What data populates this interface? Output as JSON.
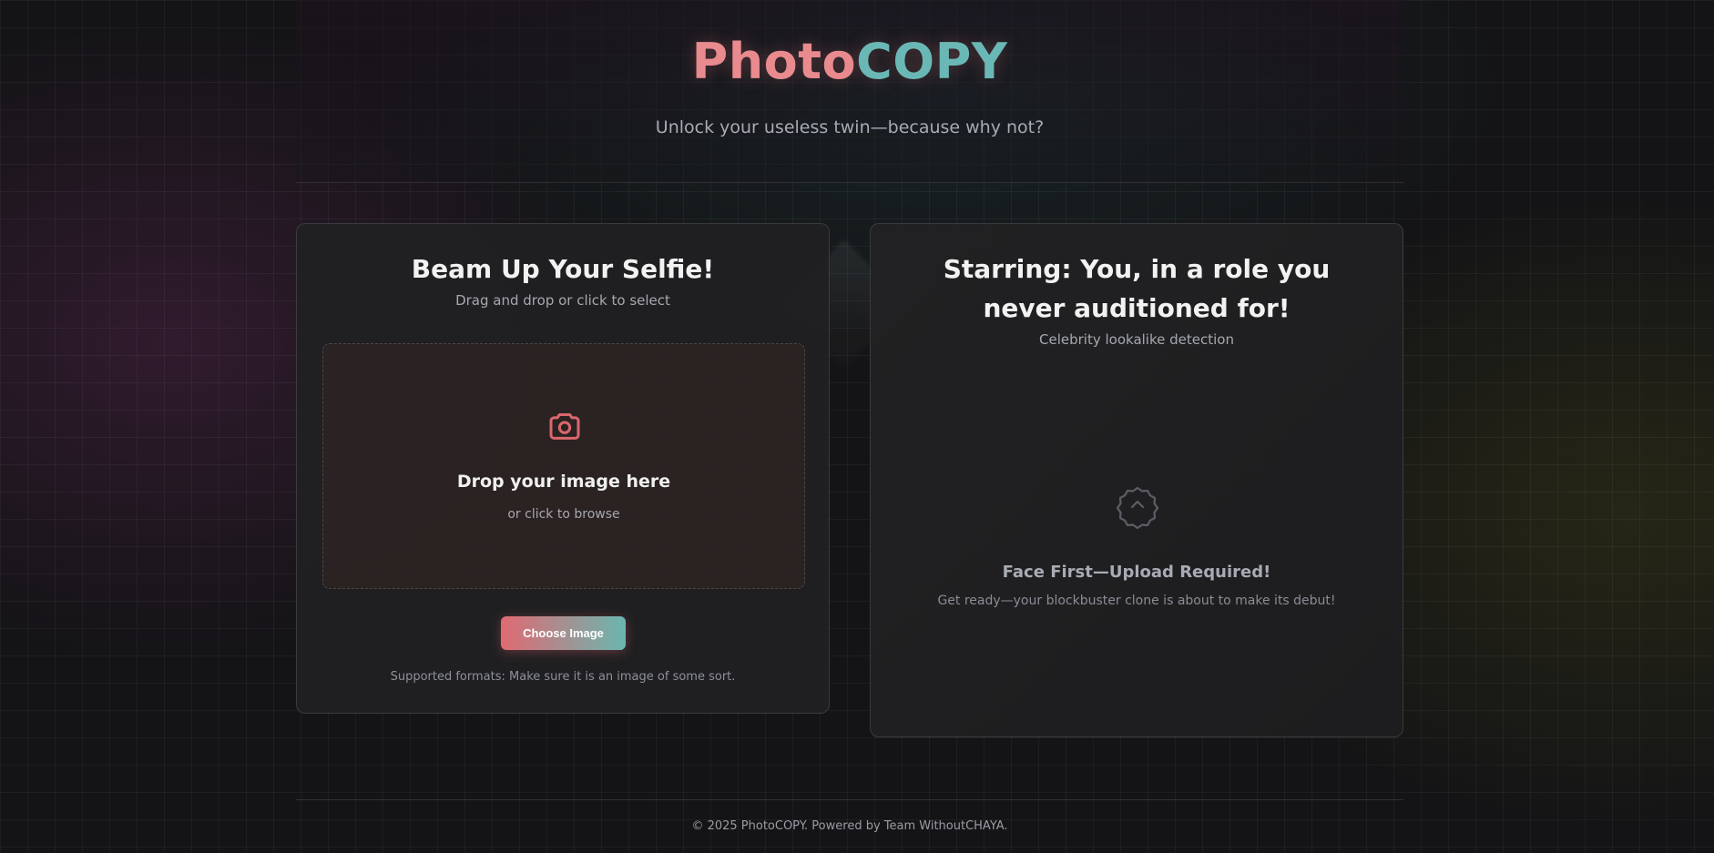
{
  "header": {
    "logo_part1": "Photo",
    "logo_part2": "COPY",
    "tagline": "Unlock your useless twin—because why not?"
  },
  "upload": {
    "title": "Beam Up Your Selfie!",
    "subtitle": "Drag and drop or click to select",
    "drop_title": "Drop your image here",
    "drop_subtitle": "or click to browse",
    "button_label": "Choose Image",
    "formats": "Supported formats: Make sure it is an image of some sort.",
    "icon": "camera-icon"
  },
  "result": {
    "title": "Starring: You, in a role you never auditioned for!",
    "subtitle": "Celebrity lookalike detection",
    "empty_title": "Face First—Upload Required!",
    "empty_subtitle": "Get ready—your blockbuster clone is about to make its debut!",
    "icon": "badge-icon"
  },
  "footer": {
    "text": "© 2025 PhotoCOPY. Powered by Team WithoutCHAYA."
  },
  "colors": {
    "accent_coral": "#e06a72",
    "accent_teal": "#6ab6b0",
    "background": "#141416"
  }
}
